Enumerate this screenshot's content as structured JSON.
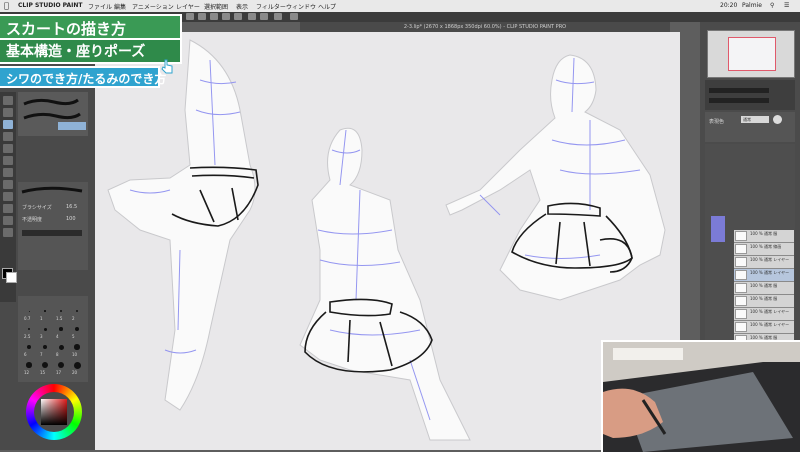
{
  "menubar": {
    "items": [
      "CLIP STUDIO PAINT",
      "ファイル",
      "編集",
      "アニメーション",
      "レイヤー",
      "選択範囲",
      "表示",
      "フィルター",
      "ウィンドウ",
      "ヘルプ"
    ],
    "clock": "20:20",
    "user": "Palmie"
  },
  "document": {
    "title": "2-3.lip* (2670 x 1868px 350dpi 60.0%) - CLIP STUDIO PAINT PRO"
  },
  "overlay": {
    "title_line1": "スカートの描き方",
    "title_line2": "基本構造・座りポーズ",
    "title_line3": "シワのでき方/たるみのでき方"
  },
  "left_panel": {
    "brush_sizes": [
      "0.7",
      "1",
      "1.5",
      "2",
      "2.5",
      "3",
      "4",
      "5",
      "6",
      "7",
      "8",
      "10",
      "12",
      "15",
      "17",
      "20"
    ],
    "size_value": "16.5",
    "density_value": "100"
  },
  "right_panel": {
    "blend_mode": "通常",
    "layers": [
      {
        "name": "100 % 通常 服"
      },
      {
        "name": "100 % 通常 線画"
      },
      {
        "name": "100 % 通常 レイヤー"
      },
      {
        "name": "100 % 通常 レイヤー"
      },
      {
        "name": "100 % 通常 服"
      },
      {
        "name": "100 % 通常 服"
      },
      {
        "name": "100 % 通常 レイヤー"
      },
      {
        "name": "100 % 通常 レイヤー"
      },
      {
        "name": "100 % 通常 服"
      },
      {
        "name": "100 % 通常 線画"
      }
    ]
  },
  "colors": {
    "title_green": "#3a9a55",
    "title_blue": "#2fa3cf",
    "mesh_blue": "#8a8cf0"
  }
}
